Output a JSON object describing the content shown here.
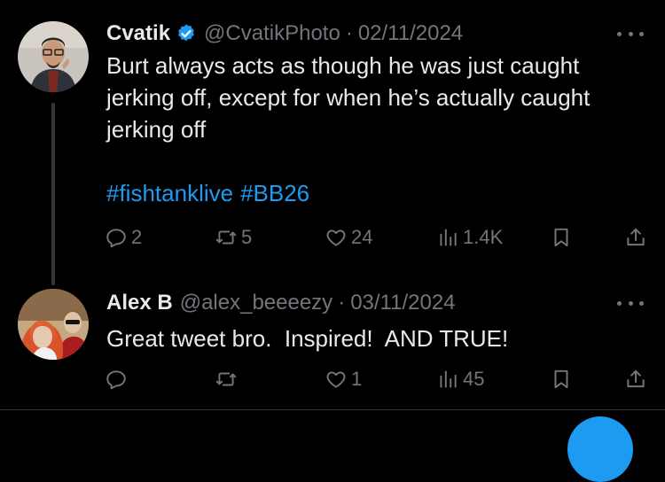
{
  "tweets": [
    {
      "author": "Cvatik",
      "handle": "@CvatikPhoto",
      "separator": "·",
      "date": "02/11/2024",
      "verified": true,
      "text": "Burt always acts as though he was just caught jerking off, except for when he’s actually caught jerking off",
      "hashtags": [
        "#fishtanklive",
        "#BB26"
      ],
      "stats": {
        "replies": "2",
        "retweets": "5",
        "likes": "24",
        "views": "1.4K"
      }
    },
    {
      "author": "Alex B",
      "handle": "@alex_beeeezy",
      "separator": "·",
      "date": "03/11/2024",
      "verified": false,
      "text": "Great tweet bro.  Inspired!  AND TRUE!",
      "hashtags": [],
      "stats": {
        "replies": "",
        "retweets": "",
        "likes": "1",
        "views": "45"
      }
    }
  ],
  "colors": {
    "background": "#000000",
    "text": "#e7e9ea",
    "muted": "#71767b",
    "accent": "#1d9bf0",
    "divider": "#2f3336"
  },
  "icons": [
    "verified-badge-icon",
    "more-icon",
    "reply-icon",
    "retweet-icon",
    "like-icon",
    "views-icon",
    "bookmark-icon",
    "share-icon"
  ]
}
